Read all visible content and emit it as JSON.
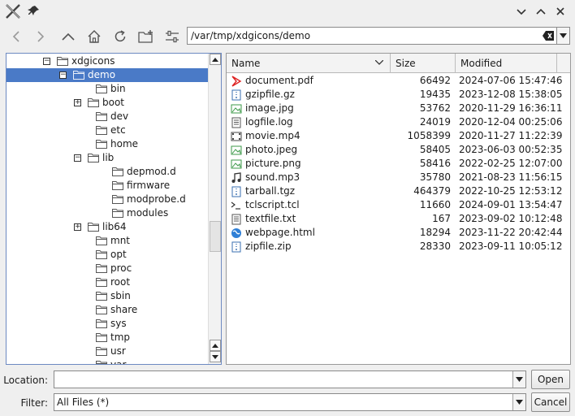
{
  "window": {
    "title": "",
    "buttons": [
      "minimize",
      "maximize",
      "close"
    ]
  },
  "toolbar": {
    "buttons": [
      "back",
      "forward",
      "up",
      "home",
      "reload",
      "new-folder",
      "options"
    ],
    "path": "/var/tmp/xdgicons/demo"
  },
  "tree": {
    "items": [
      {
        "label": "xdgicons",
        "expander": "minus"
      },
      {
        "label": "demo",
        "expander": "minus",
        "selected": true
      },
      {
        "label": "bin",
        "expander": ""
      },
      {
        "label": "boot",
        "expander": "plus"
      },
      {
        "label": "dev",
        "expander": ""
      },
      {
        "label": "etc",
        "expander": ""
      },
      {
        "label": "home",
        "expander": ""
      },
      {
        "label": "lib",
        "expander": "minus"
      },
      {
        "label": "depmod.d",
        "expander": ""
      },
      {
        "label": "firmware",
        "expander": ""
      },
      {
        "label": "modprobe.d",
        "expander": ""
      },
      {
        "label": "modules",
        "expander": ""
      },
      {
        "label": "lib64",
        "expander": "plus"
      },
      {
        "label": "mnt",
        "expander": ""
      },
      {
        "label": "opt",
        "expander": ""
      },
      {
        "label": "proc",
        "expander": ""
      },
      {
        "label": "root",
        "expander": ""
      },
      {
        "label": "sbin",
        "expander": ""
      },
      {
        "label": "share",
        "expander": ""
      },
      {
        "label": "sys",
        "expander": ""
      },
      {
        "label": "tmp",
        "expander": ""
      },
      {
        "label": "usr",
        "expander": ""
      },
      {
        "label": "var",
        "expander": ""
      }
    ]
  },
  "files": {
    "columns": {
      "name": "Name",
      "size": "Size",
      "modified": "Modified"
    },
    "rows": [
      {
        "name": "document.pdf",
        "size": "66492",
        "modified": "2024-07-06 15:47:46",
        "icon": "pdf-icon"
      },
      {
        "name": "gzipfile.gz",
        "size": "19435",
        "modified": "2023-12-08 15:38:05",
        "icon": "archive-icon"
      },
      {
        "name": "image.jpg",
        "size": "53762",
        "modified": "2020-11-29 16:36:11",
        "icon": "image-icon"
      },
      {
        "name": "logfile.log",
        "size": "24019",
        "modified": "2020-12-04 00:25:06",
        "icon": "text-icon"
      },
      {
        "name": "movie.mp4",
        "size": "1058399",
        "modified": "2020-11-27 11:22:39",
        "icon": "video-icon"
      },
      {
        "name": "photo.jpeg",
        "size": "58405",
        "modified": "2023-06-03 00:52:35",
        "icon": "image-icon"
      },
      {
        "name": "picture.png",
        "size": "58416",
        "modified": "2022-02-25 12:07:00",
        "icon": "image-icon"
      },
      {
        "name": "sound.mp3",
        "size": "35780",
        "modified": "2021-08-23 11:56:15",
        "icon": "audio-icon"
      },
      {
        "name": "tarball.tgz",
        "size": "464379",
        "modified": "2022-10-25 12:53:12",
        "icon": "archive-icon"
      },
      {
        "name": "tclscript.tcl",
        "size": "11660",
        "modified": "2024-09-01 13:54:47",
        "icon": "script-icon"
      },
      {
        "name": "textfile.txt",
        "size": "167",
        "modified": "2023-09-02 10:12:48",
        "icon": "text-icon"
      },
      {
        "name": "webpage.html",
        "size": "18294",
        "modified": "2023-11-22 20:42:44",
        "icon": "web-icon"
      },
      {
        "name": "zipfile.zip",
        "size": "28330",
        "modified": "2023-09-11 10:05:12",
        "icon": "archive-icon"
      }
    ]
  },
  "bottom": {
    "location_label": "Location:",
    "location_value": "",
    "filter_label": "Filter:",
    "filter_value": "All Files (*)",
    "open_label": "Open",
    "cancel_label": "Cancel"
  },
  "colors": {
    "selection": "#4a7ac7",
    "tree_border": "#6d8ac2"
  }
}
